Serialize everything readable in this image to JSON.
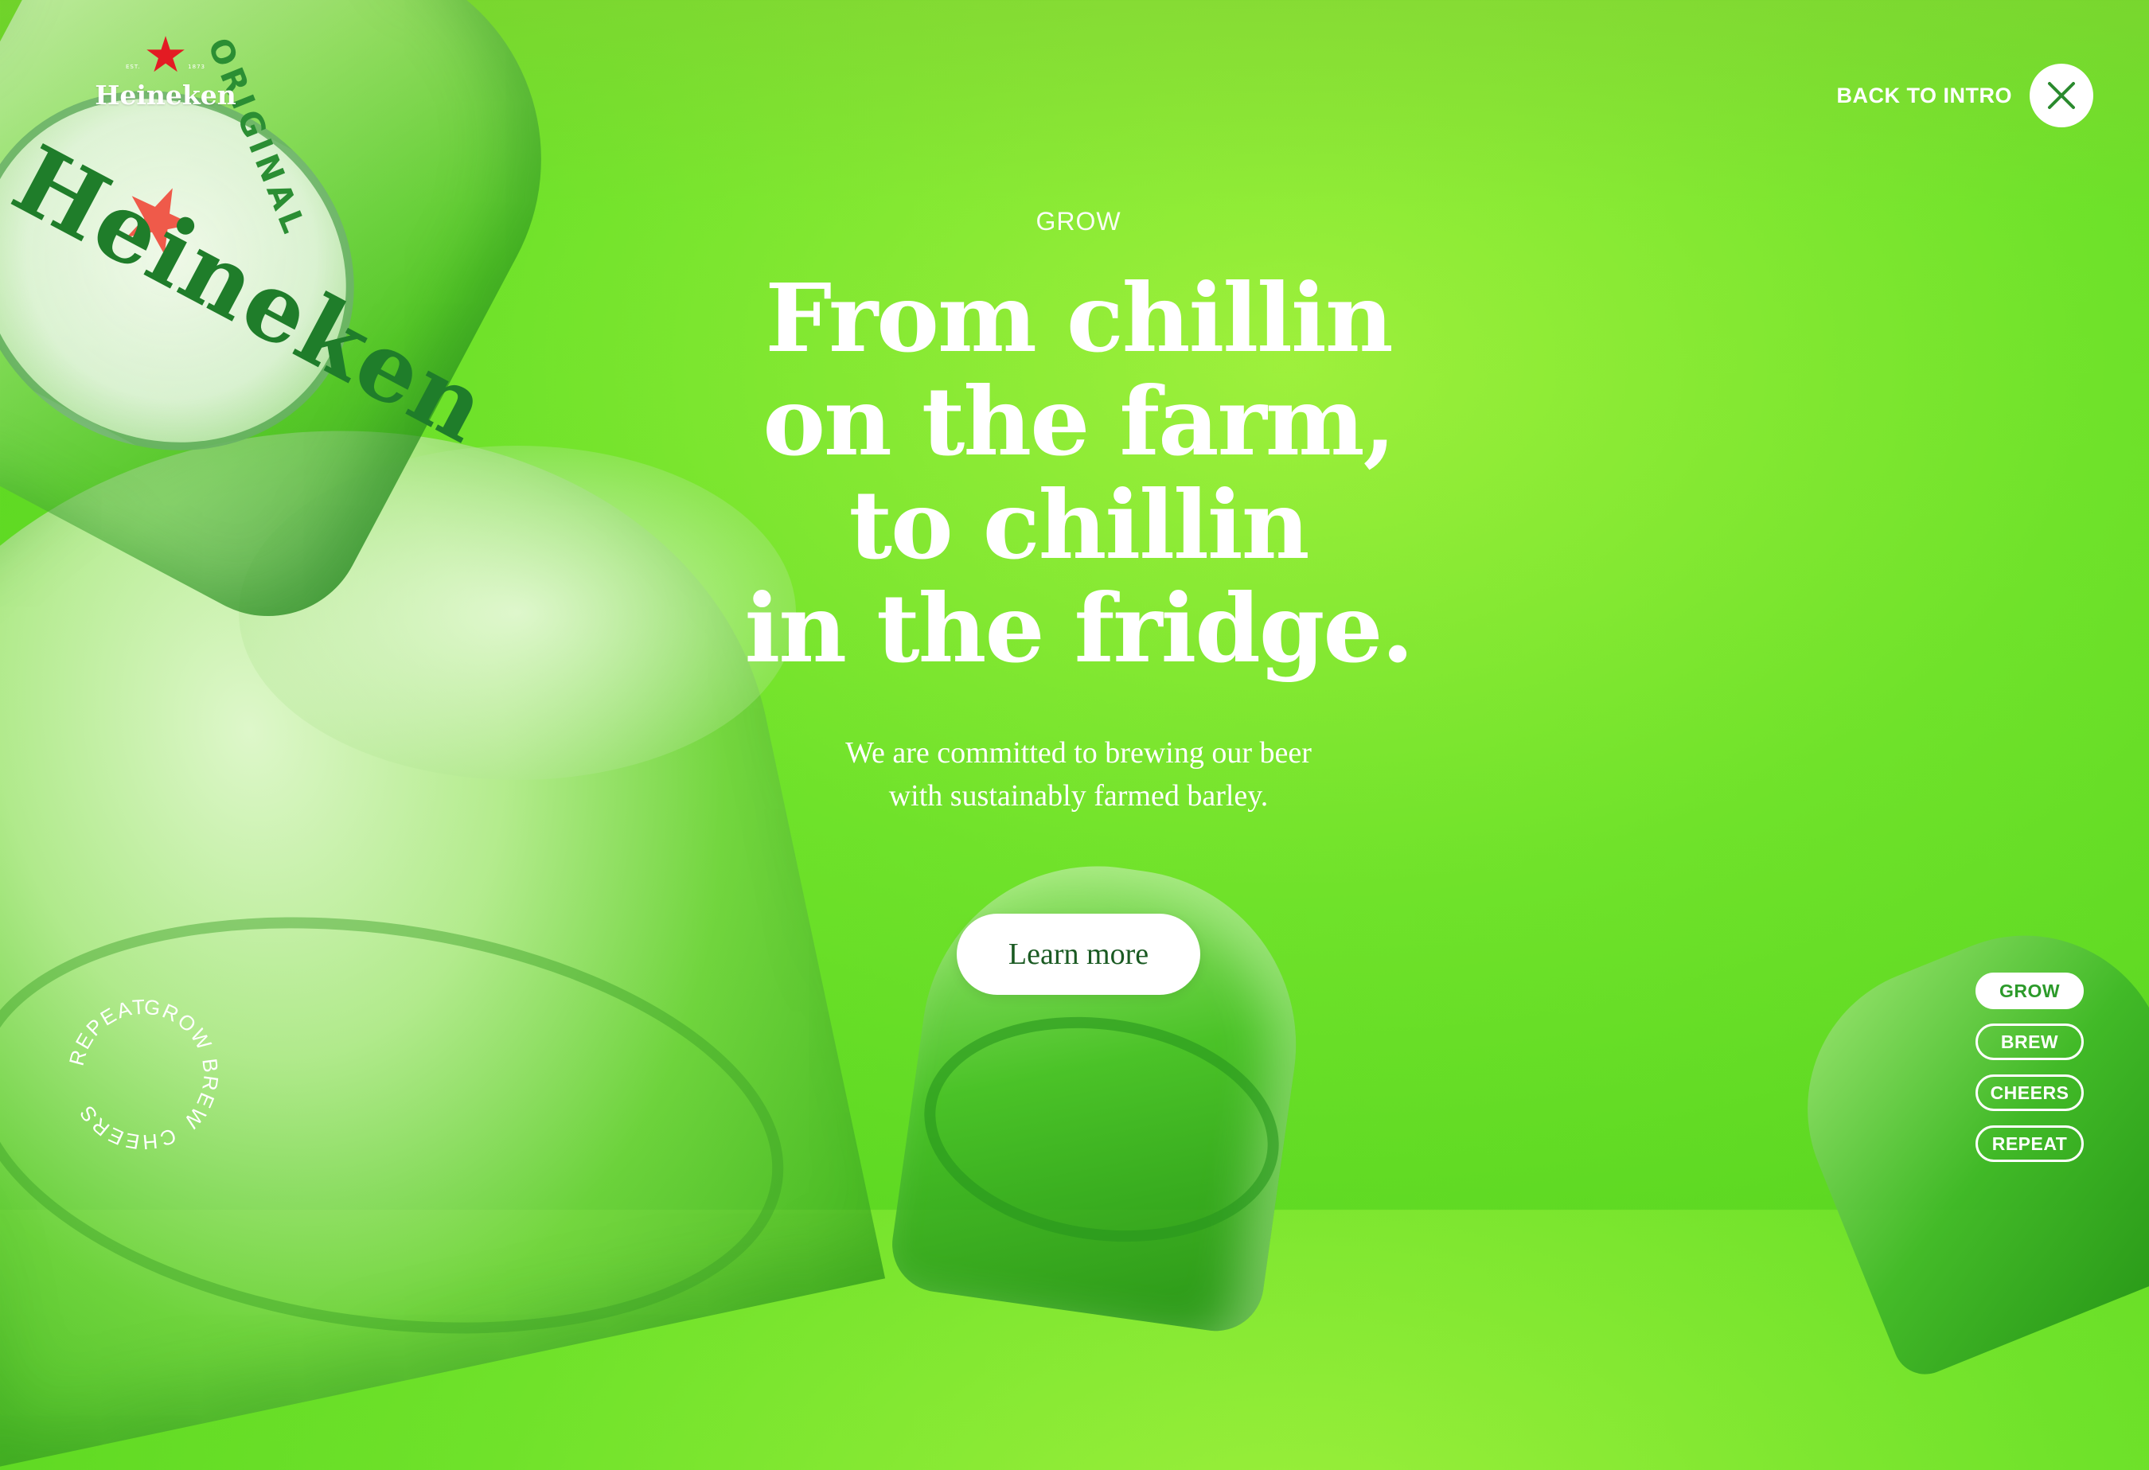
{
  "brand": {
    "name": "Heineken",
    "est_left": "EST.",
    "est_right": "1873",
    "bottle_label_text": "Heineken",
    "bottle_label_ring": "ORIGINAL"
  },
  "header": {
    "back_label": "BACK TO INTRO",
    "close_icon": "close-icon"
  },
  "hero": {
    "eyebrow": "GROW",
    "headline_lines": [
      "From chillin",
      "on the farm,",
      "to chillin",
      "in the fridge."
    ],
    "subtext_lines": [
      "We are committed to brewing our beer",
      "with sustainably farmed barley."
    ],
    "cta_label": "Learn more"
  },
  "cycle_badge": {
    "words": [
      "GROW",
      "BREW",
      "CHEERS",
      "REPEAT"
    ],
    "icon": "cycle-chevron-icon"
  },
  "steps": {
    "items": [
      {
        "label": "GROW",
        "active": true
      },
      {
        "label": "BREW",
        "active": false
      },
      {
        "label": "CHEERS",
        "active": false
      },
      {
        "label": "REPEAT",
        "active": false
      }
    ]
  },
  "colors": {
    "background": "#6fe22a",
    "text": "#ffffff",
    "cta_text": "#1a5a22",
    "brand_star": "#e31b23",
    "active_step_text": "#2c9a2a"
  }
}
